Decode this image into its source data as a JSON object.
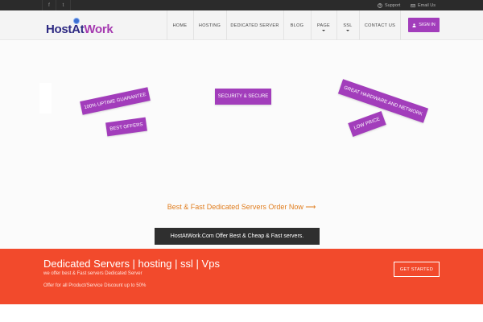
{
  "topbar": {
    "social": [
      {
        "icon": "facebook-icon",
        "glyph": "f"
      },
      {
        "icon": "twitter-icon",
        "glyph": "t"
      }
    ],
    "support_label": "Support",
    "email_label": "Email Us"
  },
  "logo": {
    "part1": "HostAt",
    "part2": "Work"
  },
  "nav": {
    "items": [
      {
        "label": "HOME"
      },
      {
        "label": "HOSTING"
      },
      {
        "label": "DEDICATED SERVER"
      },
      {
        "label": "BLOG"
      },
      {
        "label": "PAGE"
      },
      {
        "label": "SSL"
      },
      {
        "label": "CONTACT US"
      }
    ],
    "signin_label": "SIGN IN"
  },
  "hero": {
    "tags": {
      "uptime": "100% UPTIME GUARANTEE",
      "offers": "BEST OFFERS",
      "security": "SECURITY & SECURE",
      "hardware": "GREAT HARDWARE AND NETWORK",
      "price": "LOW PRICE"
    },
    "cta_link": "Best & Fast Dedicated Servers Order Now ⟶",
    "strip_text": "HostAtWork.Com Offer Best & Cheap & Fast servers."
  },
  "band": {
    "title": "Dedicated Servers | hosting | ssl | Vps",
    "subtitle": "we offer best & Fast servers Dedicated Server",
    "offer": "Offer for all Product/Service Discount up to 50%",
    "button_label": "GET STARTED"
  },
  "colors": {
    "brand_purple": "#a23dbb",
    "band_orange": "#f24a2c",
    "cta_orange": "#e07c1c",
    "topbar_dark": "#2b2b2b"
  }
}
